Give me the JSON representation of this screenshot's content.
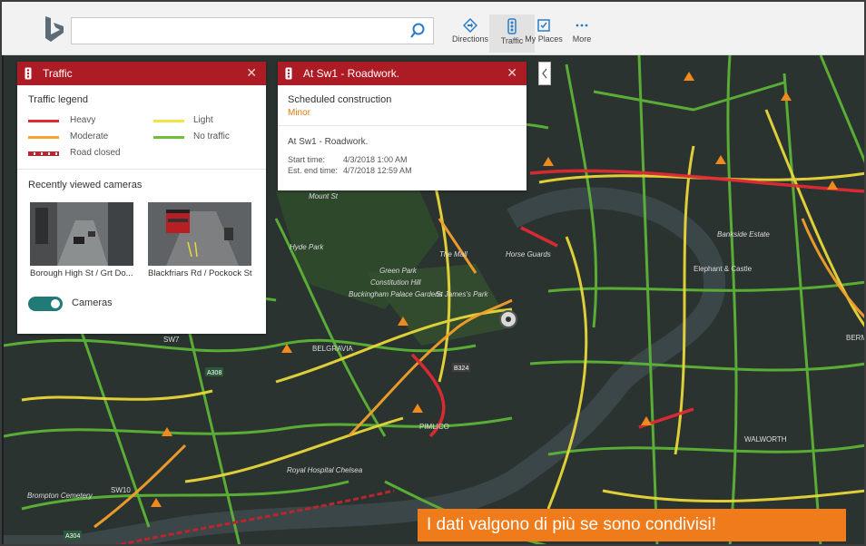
{
  "header": {
    "search_placeholder": "",
    "tools": [
      {
        "label": "Directions",
        "icon": "directions-icon"
      },
      {
        "label": "Traffic",
        "icon": "traffic-light-icon"
      },
      {
        "label": "My Places",
        "icon": "my-places-icon"
      },
      {
        "label": "More",
        "icon": "more-icon"
      }
    ]
  },
  "traffic_panel": {
    "title": "Traffic",
    "legend_title": "Traffic legend",
    "legend": [
      {
        "label": "Heavy",
        "color": "#e02a34"
      },
      {
        "label": "Light",
        "color": "#f2e24a"
      },
      {
        "label": "Moderate",
        "color": "#f7a52a"
      },
      {
        "label": "No traffic",
        "color": "#6fbf3b"
      },
      {
        "label": "Road closed",
        "color": "#b9262e"
      }
    ],
    "cameras_title": "Recently viewed cameras",
    "cameras": [
      {
        "label": "Borough High St / Grt Do..."
      },
      {
        "label": "Blackfriars Rd / Pockock St"
      }
    ],
    "toggle_label": "Cameras"
  },
  "incident_panel": {
    "title": "At Sw1 - Roadwork.",
    "category": "Scheduled construction",
    "severity": "Minor",
    "description": "At Sw1 - Roadwork.",
    "start_label": "Start time:",
    "start_value": "4/3/2018 1:00 AM",
    "end_label": "Est. end time:",
    "end_value": "4/7/2018 12:59 AM"
  },
  "map_labels": [
    "Hyde Park",
    "Green Park",
    "Constitution Hill",
    "The Mall",
    "Horse Guards",
    "Buckingham Palace Gardens",
    "St James's Park",
    "BELGRAVIA",
    "PIMLICO",
    "Royal Hospital Chelsea",
    "Brompton Cemetery",
    "Bankside Estate",
    "Elephant & Castle",
    "WALWORTH",
    "BERMONDSEY",
    "A308",
    "A304",
    "B324",
    "SW7",
    "SW10",
    "Mount St"
  ],
  "banner": "I dati valgono di più se sono condivisi!",
  "colors": {
    "header_red": "#ad1c24",
    "banner_orange": "#f07b1b",
    "accent_blue": "#0e6fbd",
    "minor_orange": "#e6780f"
  }
}
